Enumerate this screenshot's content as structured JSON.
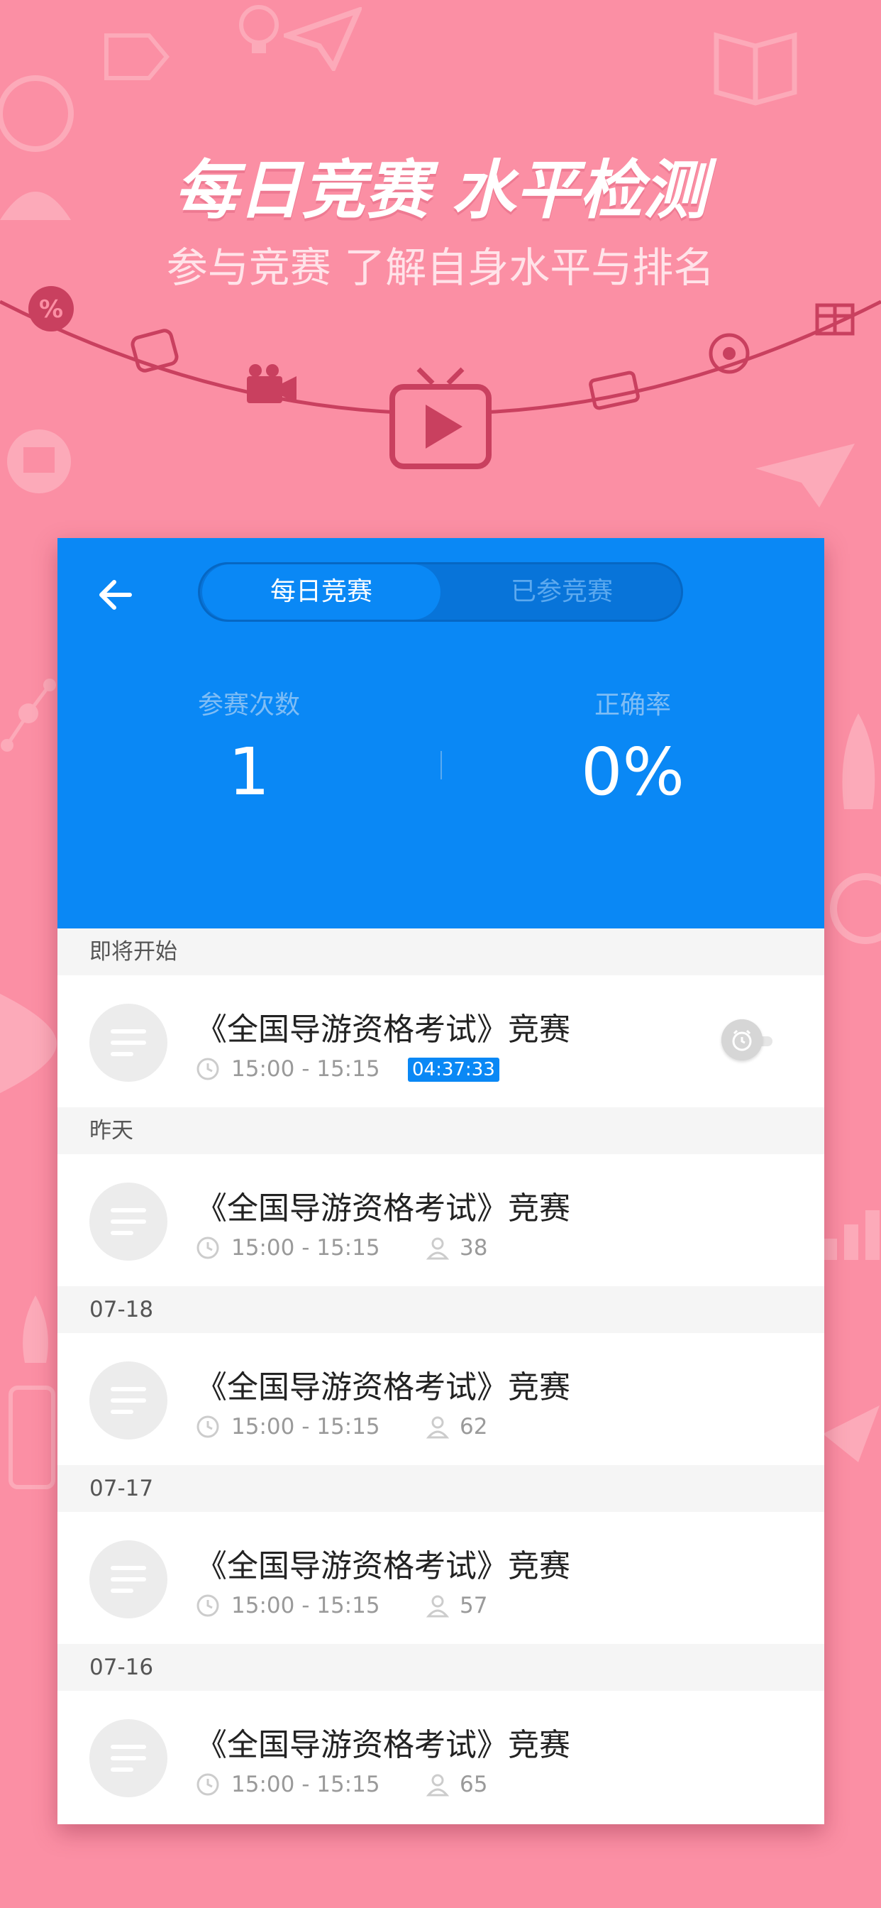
{
  "promo": {
    "headline": "每日竞赛 水平检测",
    "subline": "参与竞赛 了解自身水平与排名"
  },
  "colors": {
    "background": "#fb8fa4",
    "header_blue": "#0a88f5",
    "arc": "#c9405f"
  },
  "header": {
    "back_icon": "arrow-left-icon",
    "tabs": [
      {
        "label": "每日竞赛",
        "active": true
      },
      {
        "label": "已参竞赛",
        "active": false
      }
    ]
  },
  "stats": [
    {
      "label": "参赛次数",
      "value": "1"
    },
    {
      "label": "正确率",
      "value": "0%"
    }
  ],
  "sections": [
    {
      "heading": "即将开始",
      "items": [
        {
          "title": "《全国导游资格考试》竞赛",
          "time": "15:00 - 15:15",
          "countdown": "04:37:33"
        }
      ]
    },
    {
      "heading": "昨天",
      "items": [
        {
          "title": "《全国导游资格考试》竞赛",
          "time": "15:00 - 15:15",
          "participants": "38"
        }
      ]
    },
    {
      "heading": "07-18",
      "items": [
        {
          "title": "《全国导游资格考试》竞赛",
          "time": "15:00 - 15:15",
          "participants": "62"
        }
      ]
    },
    {
      "heading": "07-17",
      "items": [
        {
          "title": "《全国导游资格考试》竞赛",
          "time": "15:00 - 15:15",
          "participants": "57"
        }
      ]
    },
    {
      "heading": "07-16",
      "items": [
        {
          "title": "《全国导游资格考试》竞赛",
          "time": "15:00 - 15:15",
          "participants": "65"
        }
      ]
    }
  ]
}
